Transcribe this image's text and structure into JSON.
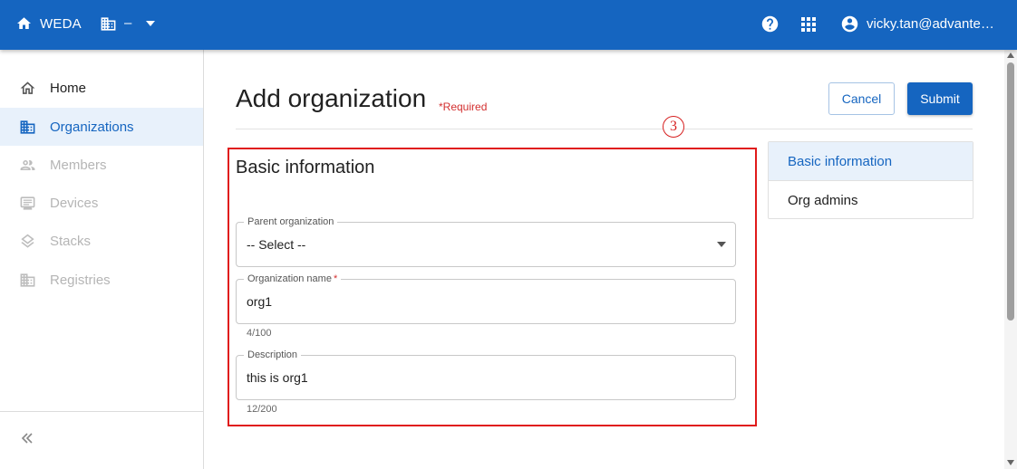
{
  "topbar": {
    "home_icon": "home-icon",
    "app_name": "WEDA",
    "org_icon": "building-icon",
    "org_value": "–",
    "help_icon": "help-circle-icon",
    "apps_icon": "apps-grid-icon",
    "user_icon": "account-circle-icon",
    "user_email": "vicky.tan@advantech.com"
  },
  "sidebar": {
    "items": [
      {
        "label": "Home",
        "icon": "home-outline-icon",
        "state": "normal"
      },
      {
        "label": "Organizations",
        "icon": "building-icon",
        "state": "active"
      },
      {
        "label": "Members",
        "icon": "people-icon",
        "state": "disabled"
      },
      {
        "label": "Devices",
        "icon": "monitor-icon",
        "state": "disabled"
      },
      {
        "label": "Stacks",
        "icon": "layers-icon",
        "state": "disabled"
      },
      {
        "label": "Registries",
        "icon": "building-icon",
        "state": "disabled"
      }
    ],
    "collapse_icon": "chevron-double-left-icon"
  },
  "main": {
    "title": "Add organization",
    "required_note": "*Required",
    "cancel_label": "Cancel",
    "submit_label": "Submit",
    "step_badge": "3",
    "section_title": "Basic information",
    "fields": {
      "parent": {
        "label": "Parent organization",
        "value": "-- Select --"
      },
      "name": {
        "label": "Organization name",
        "required_mark": "*",
        "value": "org1",
        "helper": "4/100"
      },
      "description": {
        "label": "Description",
        "value": "this is org1",
        "helper": "12/200"
      }
    }
  },
  "anchor_nav": {
    "items": [
      {
        "label": "Basic information",
        "state": "active"
      },
      {
        "label": "Org admins",
        "state": "normal"
      }
    ]
  },
  "colors": {
    "brand": "#1565c0",
    "active_bg": "#e8f1fb",
    "required": "#d32f2f",
    "highlight": "#e01b1b"
  }
}
